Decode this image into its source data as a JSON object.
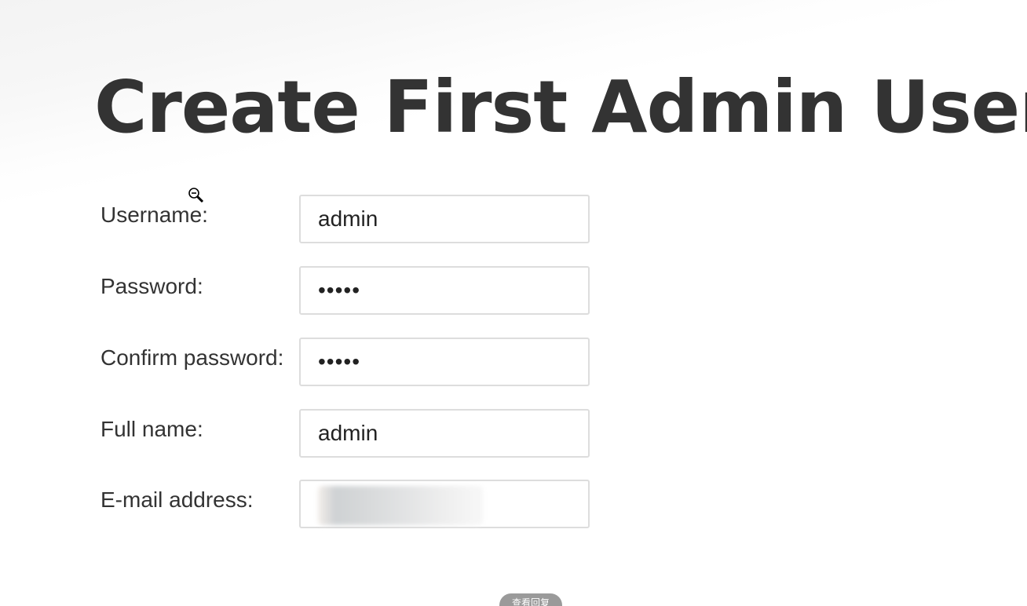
{
  "page": {
    "title": "Create First Admin User"
  },
  "form": {
    "username": {
      "label": "Username:",
      "value": "admin"
    },
    "password": {
      "label": "Password:",
      "value": "•••••"
    },
    "confirm_password": {
      "label": "Confirm password:",
      "value": "•••••"
    },
    "full_name": {
      "label": "Full name:",
      "value": "admin"
    },
    "email": {
      "label": "E-mail address:",
      "value": ""
    }
  },
  "cursor": {
    "icon": "zoom-out-icon"
  },
  "bottom_overlay": {
    "label": "查看回复"
  }
}
